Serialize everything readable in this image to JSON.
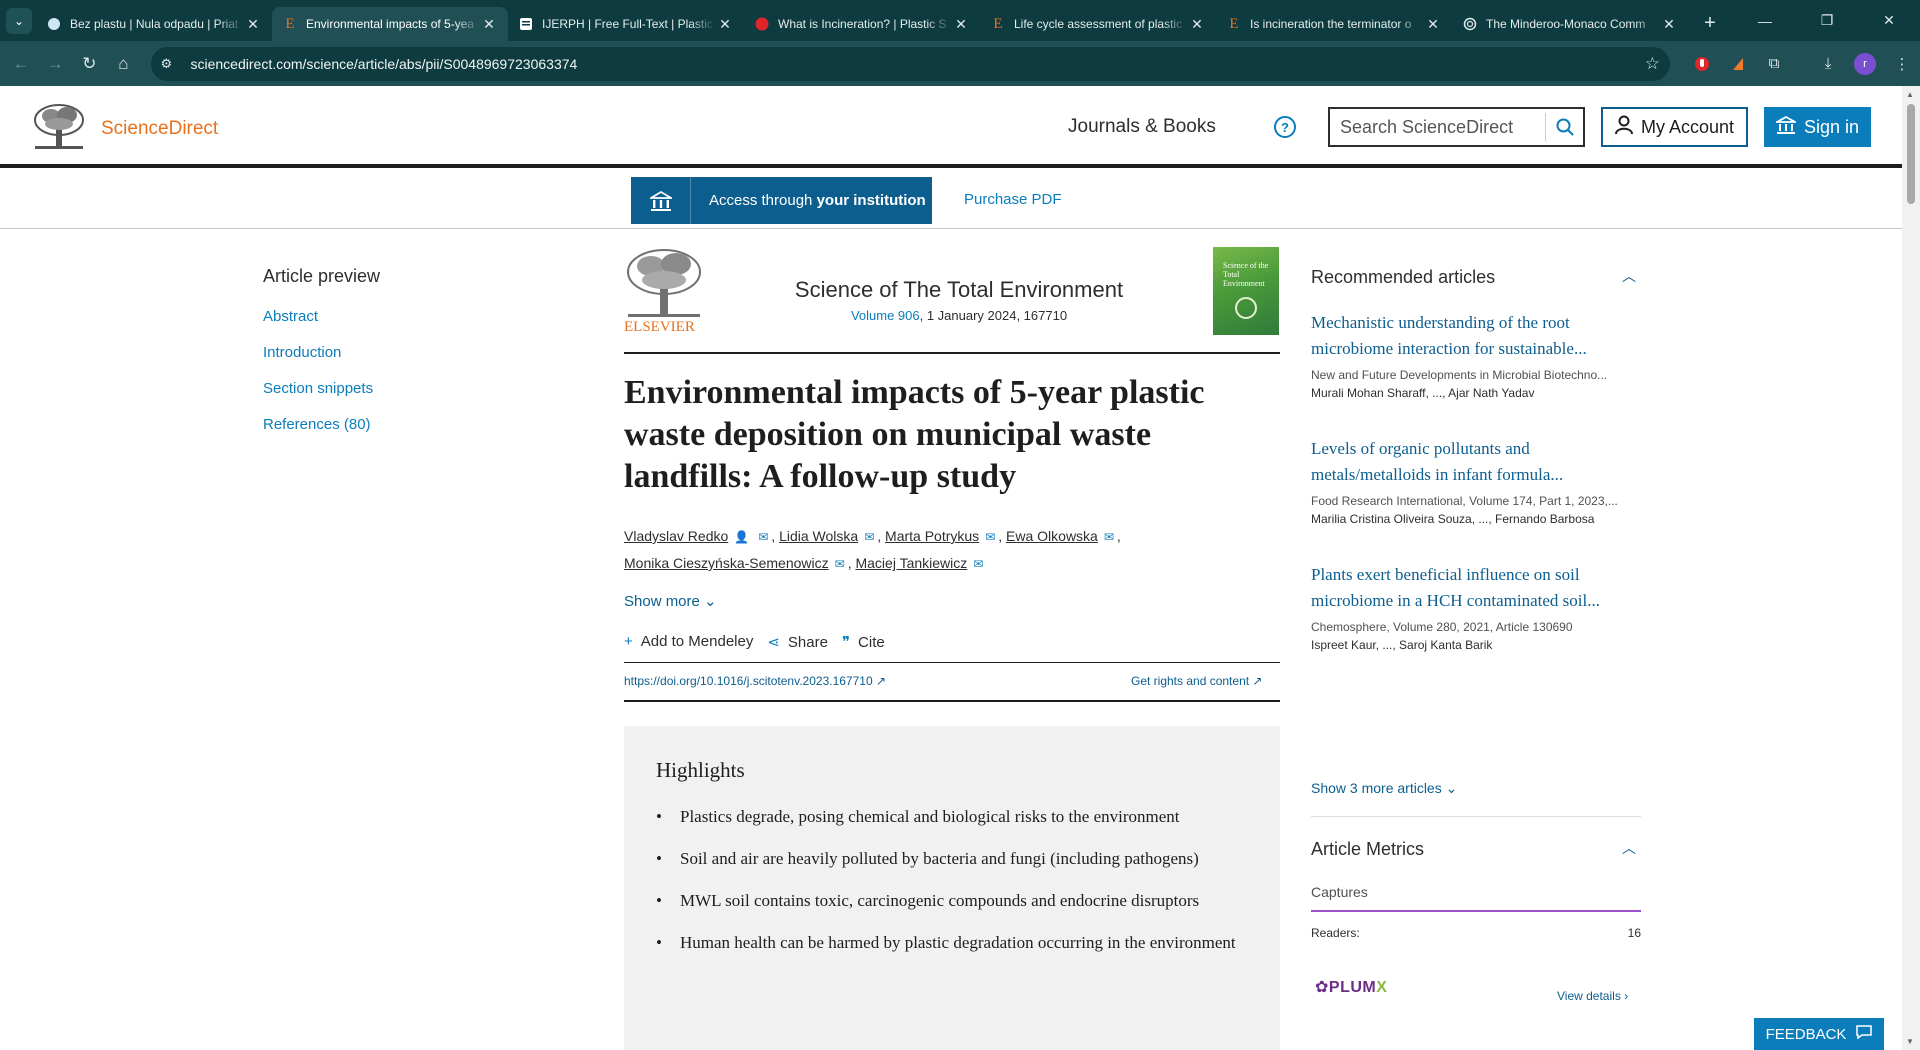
{
  "browser": {
    "tabs": [
      {
        "title": "Bez plastu | Nula odpadu | Priat",
        "favicon": "circle-light"
      },
      {
        "title": "Environmental impacts of 5-yea",
        "favicon": "E",
        "active": true
      },
      {
        "title": "IJERPH | Free Full-Text | Plastic V",
        "favicon": "doc"
      },
      {
        "title": "What is Incineration? | Plastic S",
        "favicon": "red-circle"
      },
      {
        "title": "Life cycle assessment of plastic",
        "favicon": "E"
      },
      {
        "title": "Is incineration the terminator o",
        "favicon": "E"
      },
      {
        "title": "The Minderoo-Monaco Comm",
        "favicon": "swirl"
      }
    ],
    "url": "sciencedirect.com/science/article/abs/pii/S0048969723063374",
    "avatar_letter": "r"
  },
  "header": {
    "logo_text": "ScienceDirect",
    "journals_link": "Journals & Books",
    "help_icon": "?",
    "search_placeholder": "Search ScienceDirect",
    "my_account": "My Account",
    "sign_in": "Sign in"
  },
  "access": {
    "button_prefix": "Access through ",
    "button_bold": "your institution",
    "purchase": "Purchase PDF"
  },
  "toc": {
    "title": "Article preview",
    "items": [
      "Abstract",
      "Introduction",
      "Section snippets",
      "References (80)"
    ]
  },
  "journal": {
    "publisher": "ELSEVIER",
    "title": "Science of The Total Environment",
    "volume_link": "Volume 906",
    "volume_rest": ", 1 January 2024, 167710",
    "cover_text": "Science of the Total Environment"
  },
  "article": {
    "title": "Environmental impacts of 5-year plastic waste deposition on municipal waste landfills: A follow-up study",
    "authors": [
      "Vladyslav Redko",
      "Lidia Wolska",
      "Marta Potrykus",
      "Ewa Olkowska",
      "Monika Cieszyńska-Semenowicz",
      "Maciej Tankiewicz"
    ],
    "show_more": "Show more",
    "actions": [
      "Add to Mendeley",
      "Share",
      "Cite"
    ],
    "doi": "https://doi.org/10.1016/j.scitotenv.2023.167710",
    "rights": "Get rights and content"
  },
  "highlights": {
    "heading": "Highlights",
    "items": [
      "Plastics degrade, posing chemical and biological risks to the environment",
      "Soil and air are heavily polluted by bacteria and fungi (including pathogens)",
      "MWL soil contains toxic, carcinogenic compounds and endocrine disruptors",
      "Human health can be harmed by plastic degradation occurring in the environment"
    ]
  },
  "recommended": {
    "title": "Recommended articles",
    "items": [
      {
        "title": "Mechanistic understanding of the root microbiome interaction for sustainable...",
        "source": "New and Future Developments in Microbial Biotechno...",
        "authors": "Murali Mohan Sharaff, ..., Ajar Nath Yadav"
      },
      {
        "title": "Levels of organic pollutants and metals/metalloids in infant formula...",
        "source": "Food Research International, Volume 174, Part 1, 2023,...",
        "authors": "Marilia Cristina Oliveira Souza, ..., Fernando Barbosa"
      },
      {
        "title": "Plants exert beneficial influence on soil microbiome in a HCH contaminated soil...",
        "source": "Chemosphere, Volume 280, 2021, Article 130690",
        "authors": "Ispreet Kaur, ..., Saroj Kanta Barik"
      }
    ],
    "show_more": "Show 3 more articles"
  },
  "metrics": {
    "title": "Article Metrics",
    "captures": "Captures",
    "readers_label": "Readers:",
    "readers_value": "16",
    "plumx": "PLUM",
    "plumx_x": "X",
    "view_details": "View details"
  },
  "feedback": "FEEDBACK"
}
